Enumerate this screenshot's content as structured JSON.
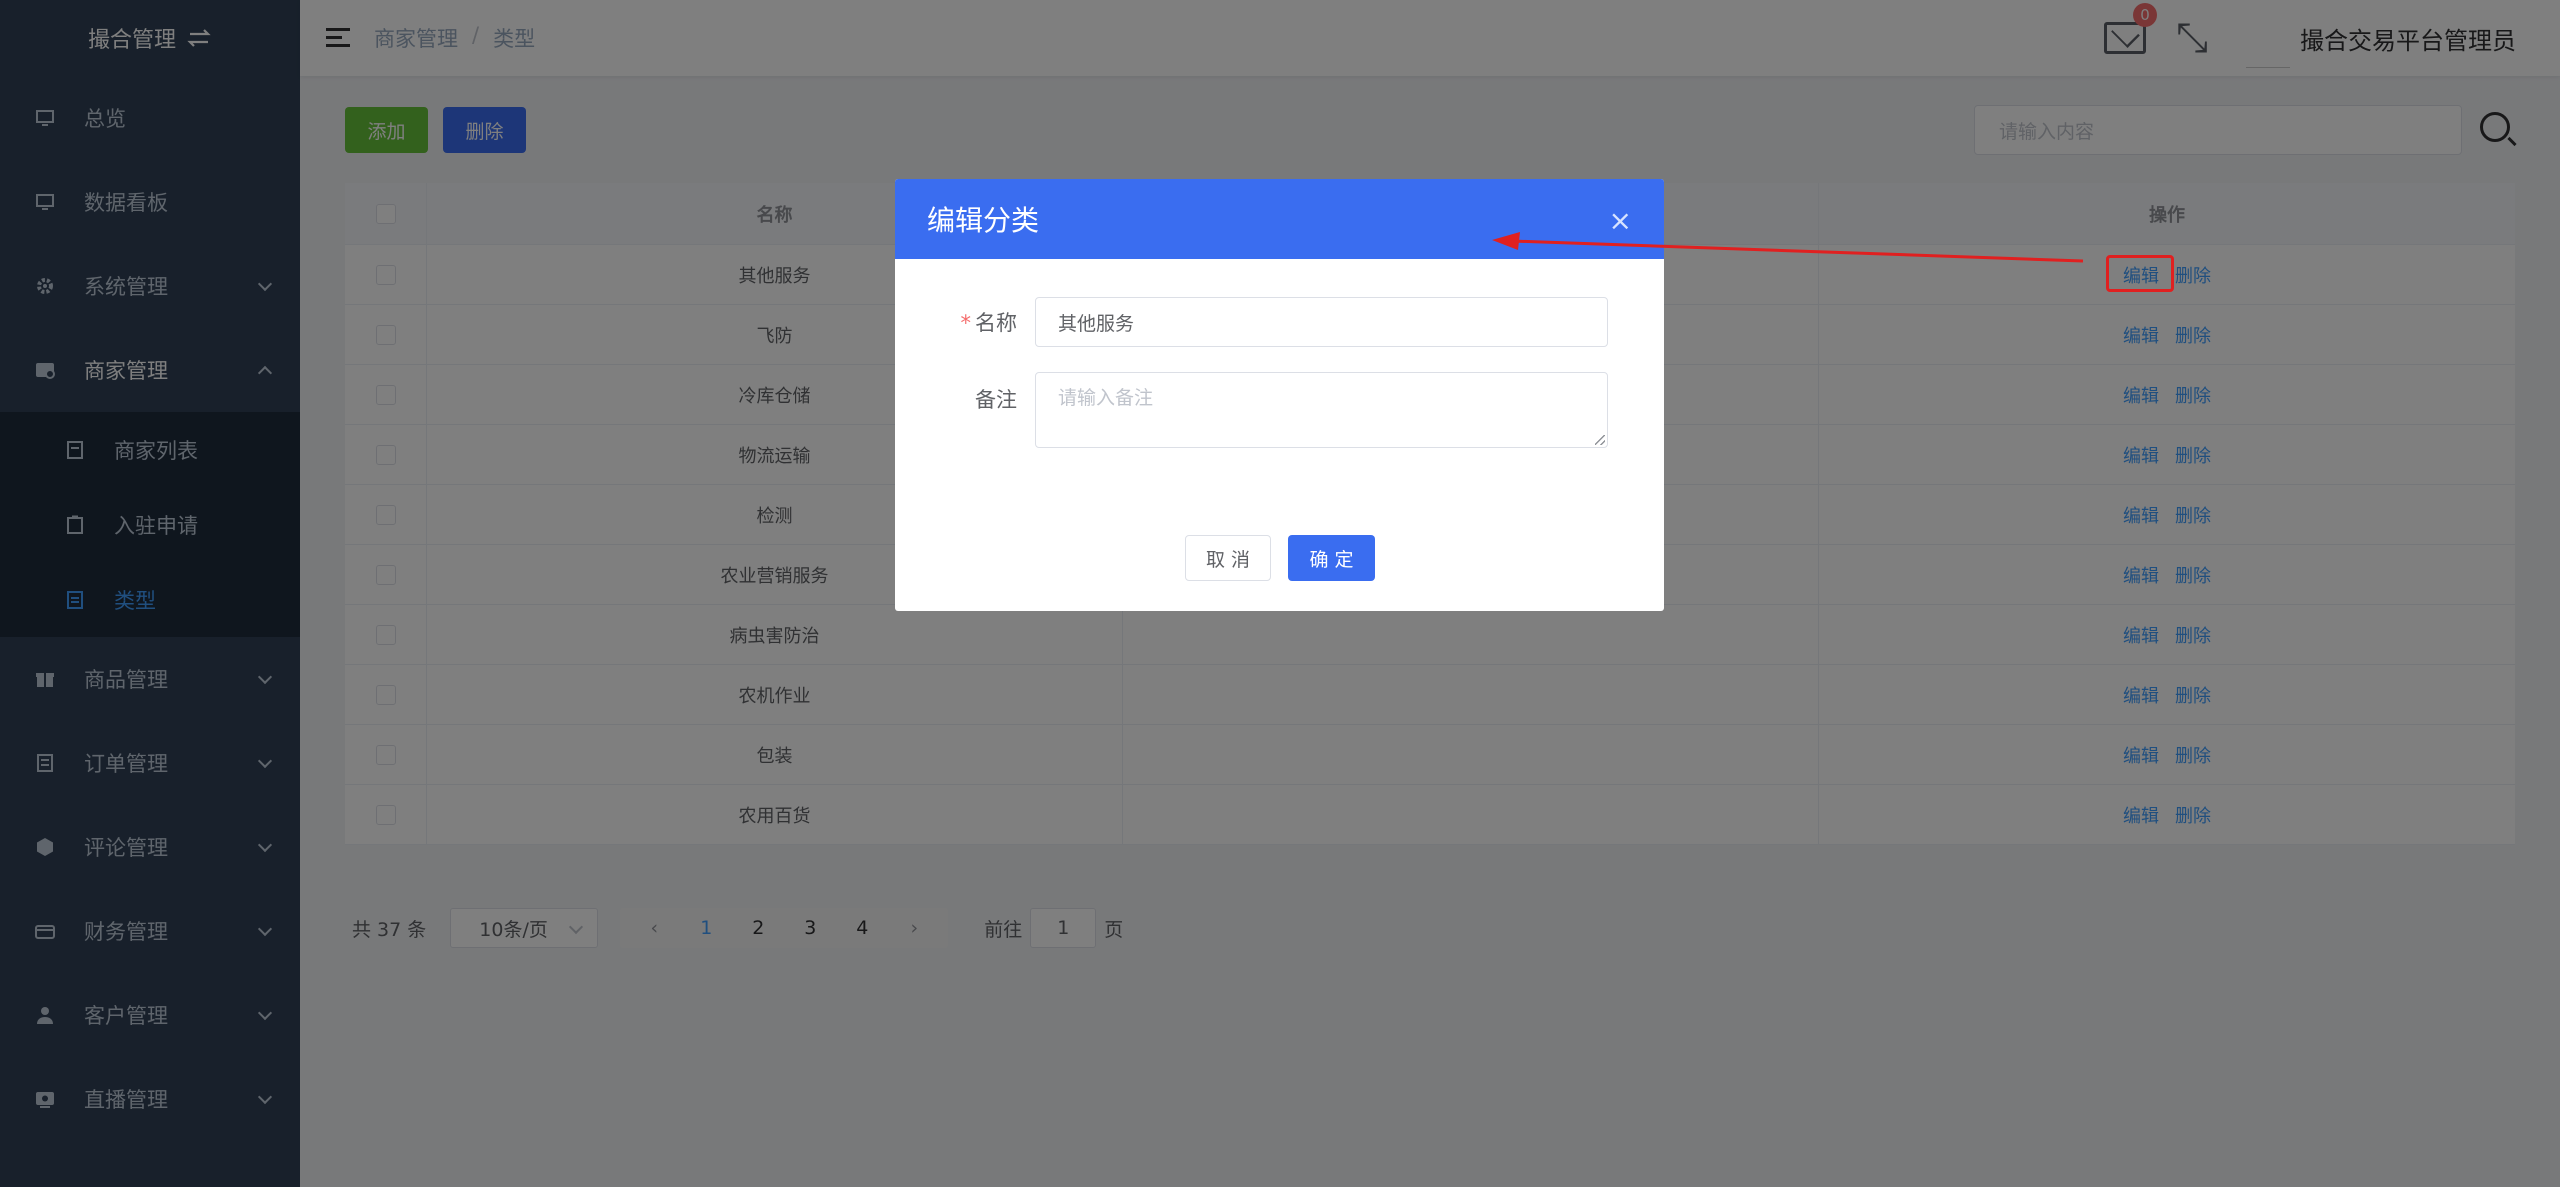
{
  "app": {
    "title": "撮合管理"
  },
  "sidebar": {
    "items": [
      {
        "label": "总览"
      },
      {
        "label": "数据看板"
      },
      {
        "label": "系统管理"
      },
      {
        "label": "商家管理"
      },
      {
        "label": "商品管理"
      },
      {
        "label": "订单管理"
      },
      {
        "label": "评论管理"
      },
      {
        "label": "财务管理"
      },
      {
        "label": "客户管理"
      },
      {
        "label": "直播管理"
      }
    ],
    "submenu": [
      {
        "label": "商家列表"
      },
      {
        "label": "入驻申请"
      },
      {
        "label": "类型"
      }
    ]
  },
  "header": {
    "breadcrumb": [
      "商家管理",
      "类型"
    ],
    "breadcrumb_sep": "/",
    "badge": "0",
    "username": "撮合交易平台管理员",
    "fullscreen_icon": "⤡"
  },
  "toolbar": {
    "add_label": "添加",
    "delete_label": "删除",
    "search_placeholder": "请输入内容"
  },
  "table": {
    "headers": {
      "name": "名称",
      "ops": "操作"
    },
    "rows": [
      {
        "name": "其他服务"
      },
      {
        "name": "飞防"
      },
      {
        "name": "冷库仓储"
      },
      {
        "name": "物流运输"
      },
      {
        "name": "检测"
      },
      {
        "name": "农业营销服务"
      },
      {
        "name": "病虫害防治"
      },
      {
        "name": "农机作业"
      },
      {
        "name": "包装"
      },
      {
        "name": "农用百货"
      }
    ],
    "edit_label": "编辑",
    "delete_label": "删除"
  },
  "pagination": {
    "total": "共 37 条",
    "page_size": "10条/页",
    "pages": [
      "1",
      "2",
      "3",
      "4"
    ],
    "current": "1",
    "goto_prefix": "前往",
    "goto_value": "1",
    "goto_suffix": "页"
  },
  "dialog": {
    "title": "编辑分类",
    "close": "×",
    "name_label": "名称",
    "name_value": "其他服务",
    "remark_label": "备注",
    "remark_placeholder": "请输入备注",
    "cancel_label": "取 消",
    "ok_label": "确 定"
  },
  "colors": {
    "sidebar_bg": "#304156",
    "primary": "#3a6df0",
    "success": "#67c23a",
    "annotation_red": "#e02020"
  }
}
